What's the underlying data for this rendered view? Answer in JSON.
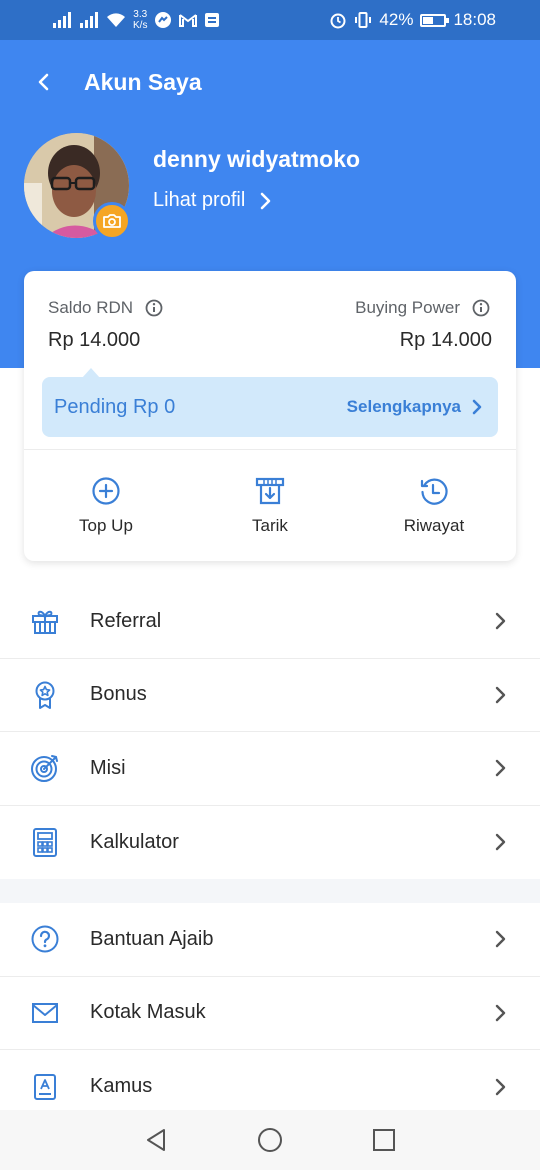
{
  "status_bar": {
    "speed_value": "3.3",
    "speed_unit": "K/s",
    "battery": "42%",
    "time": "18:08",
    "battery_level": 0.42
  },
  "header": {
    "title": "Akun Saya",
    "user_name": "denny widyatmoko",
    "profile_link": "Lihat profil"
  },
  "balance": {
    "rdn_label": "Saldo RDN",
    "rdn_value": "Rp 14.000",
    "buying_power_label": "Buying Power",
    "buying_power_value": "Rp 14.000",
    "pending_text": "Pending Rp 0",
    "pending_link": "Selengkapnya"
  },
  "actions": [
    {
      "label": "Top Up",
      "icon": "plus-circle-icon"
    },
    {
      "label": "Tarik",
      "icon": "withdraw-icon"
    },
    {
      "label": "Riwayat",
      "icon": "history-icon"
    }
  ],
  "menu_primary": [
    {
      "label": "Referral",
      "icon": "gift-icon"
    },
    {
      "label": "Bonus",
      "icon": "medal-icon"
    },
    {
      "label": "Misi",
      "icon": "target-icon"
    },
    {
      "label": "Kalkulator",
      "icon": "calculator-icon"
    }
  ],
  "menu_secondary": [
    {
      "label": "Bantuan Ajaib",
      "icon": "help-icon"
    },
    {
      "label": "Kotak Masuk",
      "icon": "mail-icon"
    },
    {
      "label": "Kamus",
      "icon": "dictionary-icon"
    }
  ],
  "colors": {
    "status_bar": "#2e6fc7",
    "header": "#3f86f0",
    "accent": "#3a7fd6",
    "pending_bg": "#d2e9fb",
    "camera_badge": "#f5a524"
  }
}
